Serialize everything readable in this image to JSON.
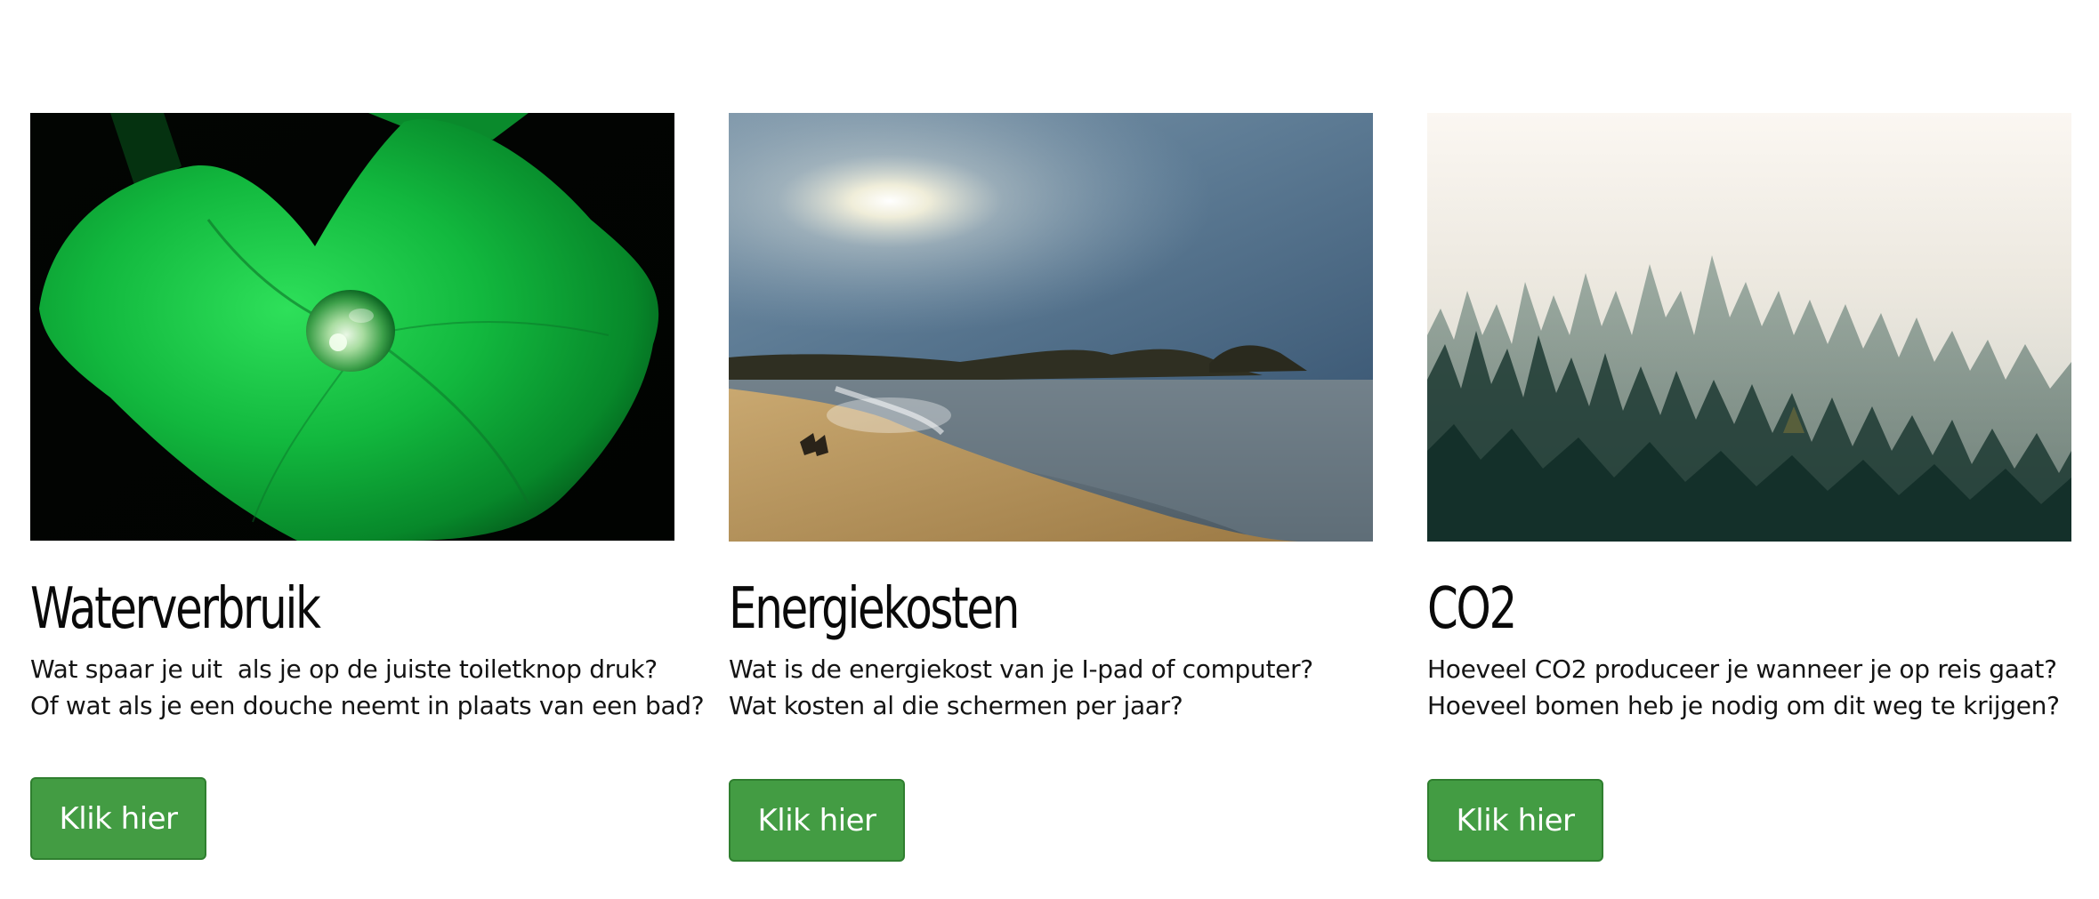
{
  "cards": [
    {
      "title": "Waterverbruik",
      "lines": [
        "Wat spaar je uit  als je op de juiste toiletknop druk?",
        "Of wat als je een douche neemt in plaats van een bad?"
      ],
      "button_label": "Klik hier",
      "image": "green-leaf-with-water-drop"
    },
    {
      "title": "Energiekosten",
      "lines": [
        "Wat is de energiekost van je I-pad of computer?",
        "Wat kosten al die schermen per jaar?"
      ],
      "button_label": "Klik hier",
      "image": "sunny-beach-coastline"
    },
    {
      "title": "CO2",
      "lines": [
        "Hoeveel CO2 produceer je wanneer je op reis gaat?",
        "Hoeveel bomen heb je nodig om dit weg te krijgen?"
      ],
      "button_label": "Klik hier",
      "image": "misty-pine-forest"
    }
  ],
  "colors": {
    "button": "#439c43",
    "button_border": "#2f7f2f",
    "background": "#ffffff",
    "title": "#0a0a0a"
  }
}
